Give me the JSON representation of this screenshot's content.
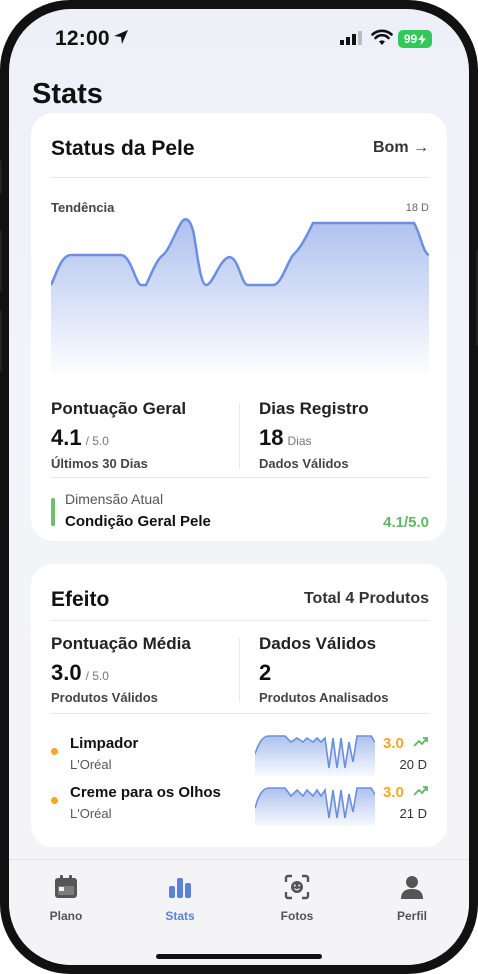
{
  "status_bar": {
    "time": "12:00",
    "battery": "99"
  },
  "page": {
    "title": "Stats"
  },
  "skin_card": {
    "title": "Status da Pele",
    "status": "Bom →",
    "chart": {
      "label": "Tendência",
      "max_label": "18 D",
      "color": "#6b8fe0"
    },
    "overall": {
      "label": "Pontuação Geral",
      "value": "4.1",
      "unit": "/ 5.0",
      "sub": "Últimos 30 Dias"
    },
    "days": {
      "label": "Dias Registro",
      "value": "18",
      "unit": "Dias",
      "sub": "Dados Válidos"
    },
    "dimension": {
      "label": "Dimensão Atual",
      "value": "Condição Geral Pele",
      "score": "4.1/5.0"
    }
  },
  "effect_card": {
    "title": "Efeito",
    "total": "Total 4 Produtos",
    "avg": {
      "label": "Pontuação Média",
      "value": "3.0",
      "unit": "/ 5.0",
      "sub": "Produtos Válidos"
    },
    "valid": {
      "label": "Dados Válidos",
      "value": "2",
      "sub": "Produtos Analisados"
    },
    "products": [
      {
        "name": "Limpador",
        "brand": "L'Oréal",
        "score": "3.0",
        "days": "20 D"
      },
      {
        "name": "Creme para os Olhos",
        "brand": "L'Oréal",
        "score": "3.0",
        "days": "21 D"
      }
    ]
  },
  "tabs": [
    {
      "label": "Plano",
      "icon": "calendar-icon"
    },
    {
      "label": "Stats",
      "icon": "bar-chart-icon"
    },
    {
      "label": "Fotos",
      "icon": "face-scan-icon"
    },
    {
      "label": "Perfil",
      "icon": "person-icon"
    }
  ],
  "colors": {
    "accent": "#5b82d6",
    "score": "#f5a623",
    "good": "#5fb866"
  }
}
